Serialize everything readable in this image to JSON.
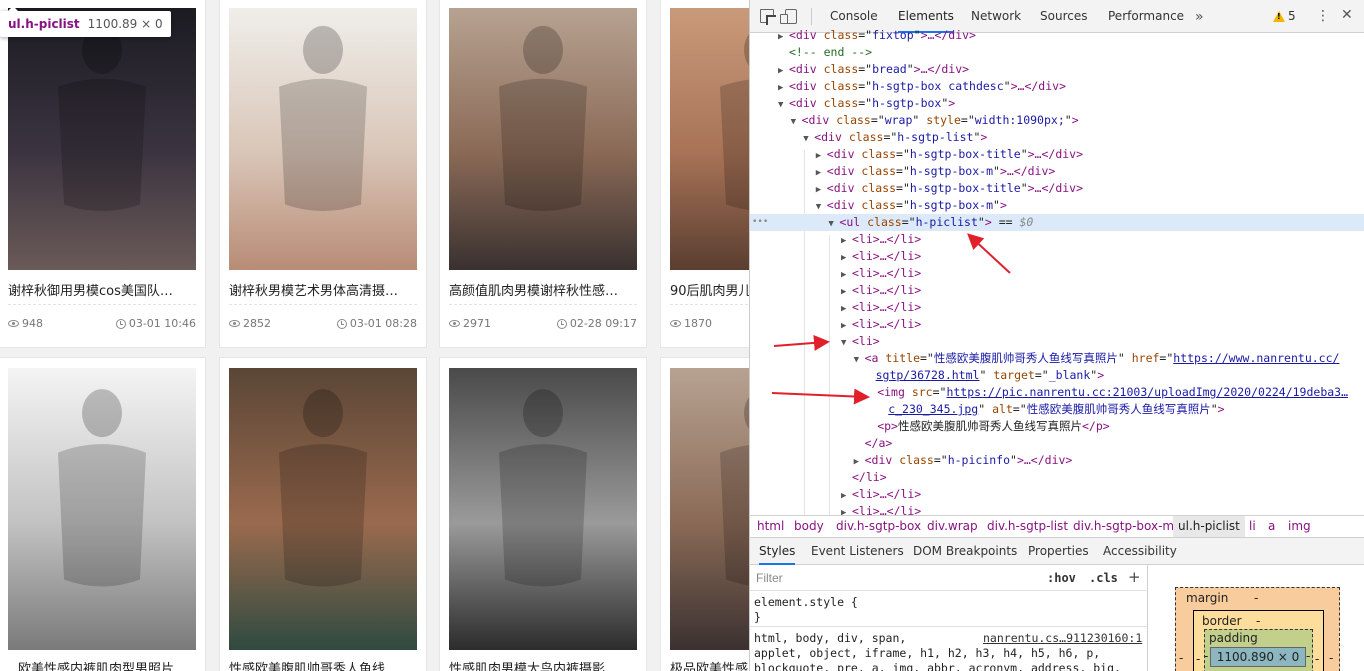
{
  "webpage": {
    "tooltip": {
      "selector": "ul.h-piclist",
      "dimensions": "1100.89 × 0"
    },
    "cards": [
      {
        "title": "谢梓秋御用男模cos美国队…",
        "views": "948",
        "date": "03-01 10:46",
        "photo_tone": "dark"
      },
      {
        "title": "谢梓秋男模艺术男体高清摄…",
        "views": "2852",
        "date": "03-01 08:28",
        "photo_tone": "light"
      },
      {
        "title": "高颜值肌肉男模谢梓秋性感…",
        "views": "2971",
        "date": "02-28 09:17",
        "photo_tone": "warm"
      },
      {
        "title": "90后肌肉男儿",
        "views": "1870",
        "date": "",
        "photo_tone": "tan"
      },
      {
        "title": "欧美性感内裤肌肉型男照片",
        "views": "",
        "date": "",
        "photo_tone": "bw"
      },
      {
        "title": "性感欧美腹肌帅哥秀人鱼线…",
        "views": "",
        "date": "",
        "photo_tone": "tan-green"
      },
      {
        "title": "性感肌肉男模大鸟内裤摄影…",
        "views": "",
        "date": "",
        "photo_tone": "bw-dark"
      },
      {
        "title": "极品欧美性感",
        "views": "",
        "date": "",
        "photo_tone": "warm"
      }
    ]
  },
  "devtools": {
    "tabs": [
      "Console",
      "Elements",
      "Network",
      "Sources",
      "Performance"
    ],
    "active_tab": "Elements",
    "more_tabs_icon": "»",
    "warning_count": "5",
    "dom_lines": [
      {
        "indent": 0,
        "tri": "▶",
        "parts": [
          [
            "tag",
            "<div "
          ],
          [
            "attr",
            "class"
          ],
          [
            "eq",
            "=\""
          ],
          [
            "val",
            "fixtop"
          ],
          [
            "eq",
            "\""
          ],
          [
            "tag",
            ">…</div>"
          ]
        ]
      },
      {
        "indent": 0,
        "tri": "",
        "parts": [
          [
            "cmt",
            "<!-- end -->"
          ]
        ]
      },
      {
        "indent": 0,
        "tri": "▶",
        "parts": [
          [
            "tag",
            "<div "
          ],
          [
            "attr",
            "class"
          ],
          [
            "eq",
            "=\""
          ],
          [
            "val",
            "bread"
          ],
          [
            "eq",
            "\""
          ],
          [
            "tag",
            ">…</div>"
          ]
        ]
      },
      {
        "indent": 0,
        "tri": "▶",
        "parts": [
          [
            "tag",
            "<div "
          ],
          [
            "attr",
            "class"
          ],
          [
            "eq",
            "=\""
          ],
          [
            "val",
            "h-sgtp-box cathdesc"
          ],
          [
            "eq",
            "\""
          ],
          [
            "tag",
            ">…</div>"
          ]
        ]
      },
      {
        "indent": 0,
        "tri": "▼",
        "parts": [
          [
            "tag",
            "<div "
          ],
          [
            "attr",
            "class"
          ],
          [
            "eq",
            "=\""
          ],
          [
            "val",
            "h-sgtp-box"
          ],
          [
            "eq",
            "\""
          ],
          [
            "tag",
            ">"
          ]
        ]
      },
      {
        "indent": 1,
        "tri": "▼",
        "parts": [
          [
            "tag",
            "<div "
          ],
          [
            "attr",
            "class"
          ],
          [
            "eq",
            "=\""
          ],
          [
            "val",
            "wrap"
          ],
          [
            "eq",
            "\" "
          ],
          [
            "attr",
            "style"
          ],
          [
            "eq",
            "=\""
          ],
          [
            "val",
            "width:1090px;"
          ],
          [
            "eq",
            "\""
          ],
          [
            "tag",
            ">"
          ]
        ]
      },
      {
        "indent": 2,
        "tri": "▼",
        "parts": [
          [
            "tag",
            "<div "
          ],
          [
            "attr",
            "class"
          ],
          [
            "eq",
            "=\""
          ],
          [
            "val",
            "h-sgtp-list"
          ],
          [
            "eq",
            "\""
          ],
          [
            "tag",
            ">"
          ]
        ]
      },
      {
        "indent": 3,
        "tri": "▶",
        "parts": [
          [
            "tag",
            "<div "
          ],
          [
            "attr",
            "class"
          ],
          [
            "eq",
            "=\""
          ],
          [
            "val",
            "h-sgtp-box-title"
          ],
          [
            "eq",
            "\""
          ],
          [
            "tag",
            ">…</div>"
          ]
        ]
      },
      {
        "indent": 3,
        "tri": "▶",
        "parts": [
          [
            "tag",
            "<div "
          ],
          [
            "attr",
            "class"
          ],
          [
            "eq",
            "=\""
          ],
          [
            "val",
            "h-sgtp-box-m"
          ],
          [
            "eq",
            "\""
          ],
          [
            "tag",
            ">…</div>"
          ]
        ]
      },
      {
        "indent": 3,
        "tri": "▶",
        "parts": [
          [
            "tag",
            "<div "
          ],
          [
            "attr",
            "class"
          ],
          [
            "eq",
            "=\""
          ],
          [
            "val",
            "h-sgtp-box-title"
          ],
          [
            "eq",
            "\""
          ],
          [
            "tag",
            ">…</div>"
          ]
        ]
      },
      {
        "indent": 3,
        "tri": "▼",
        "parts": [
          [
            "tag",
            "<div "
          ],
          [
            "attr",
            "class"
          ],
          [
            "eq",
            "=\""
          ],
          [
            "val",
            "h-sgtp-box-m"
          ],
          [
            "eq",
            "\""
          ],
          [
            "tag",
            ">"
          ]
        ]
      },
      {
        "indent": 4,
        "tri": "▼",
        "selected": true,
        "parts": [
          [
            "tag",
            "<ul "
          ],
          [
            "attr",
            "class"
          ],
          [
            "eq",
            "=\""
          ],
          [
            "val",
            "h-piclist"
          ],
          [
            "eq",
            "\""
          ],
          [
            "tag",
            ">"
          ],
          [
            "eq",
            " == "
          ],
          [
            "sel",
            "$0"
          ]
        ]
      },
      {
        "indent": 5,
        "tri": "▶",
        "parts": [
          [
            "tag",
            "<li>…</li>"
          ]
        ]
      },
      {
        "indent": 5,
        "tri": "▶",
        "parts": [
          [
            "tag",
            "<li>…</li>"
          ]
        ]
      },
      {
        "indent": 5,
        "tri": "▶",
        "parts": [
          [
            "tag",
            "<li>…</li>"
          ]
        ]
      },
      {
        "indent": 5,
        "tri": "▶",
        "parts": [
          [
            "tag",
            "<li>…</li>"
          ]
        ]
      },
      {
        "indent": 5,
        "tri": "▶",
        "parts": [
          [
            "tag",
            "<li>…</li>"
          ]
        ]
      },
      {
        "indent": 5,
        "tri": "▶",
        "parts": [
          [
            "tag",
            "<li>…</li>"
          ]
        ]
      },
      {
        "indent": 5,
        "tri": "▼",
        "parts": [
          [
            "tag",
            "<li>"
          ]
        ]
      },
      {
        "indent": 6,
        "tri": "▼",
        "parts": [
          [
            "tag",
            "<a "
          ],
          [
            "attr",
            "title"
          ],
          [
            "eq",
            "=\""
          ],
          [
            "val",
            "性感欧美腹肌帅哥秀人鱼线写真照片"
          ],
          [
            "eq",
            "\" "
          ],
          [
            "attr",
            "href"
          ],
          [
            "eq",
            "=\""
          ],
          [
            "lnk",
            "https://www.nanrentu.cc/"
          ]
        ]
      },
      {
        "indent": 6,
        "tri": "",
        "parts": [
          [
            "lnk",
            "sgtp/36728.html"
          ],
          [
            "eq",
            "\" "
          ],
          [
            "attr",
            "target"
          ],
          [
            "eq",
            "=\""
          ],
          [
            "val",
            "_blank"
          ],
          [
            "eq",
            "\""
          ],
          [
            "tag",
            ">"
          ]
        ]
      },
      {
        "indent": 7,
        "tri": "",
        "parts": [
          [
            "tag",
            "<img "
          ],
          [
            "attr",
            "src"
          ],
          [
            "eq",
            "=\""
          ],
          [
            "lnk",
            "https://pic.nanrentu.cc:21003/uploadImg/2020/0224/19deba3…"
          ]
        ]
      },
      {
        "indent": 7,
        "tri": "",
        "parts": [
          [
            "lnk",
            "c_230_345.jpg"
          ],
          [
            "eq",
            "\" "
          ],
          [
            "attr",
            "alt"
          ],
          [
            "eq",
            "=\""
          ],
          [
            "val",
            "性感欧美腹肌帅哥秀人鱼线写真照片"
          ],
          [
            "eq",
            "\""
          ],
          [
            "tag",
            ">"
          ]
        ]
      },
      {
        "indent": 7,
        "tri": "",
        "parts": [
          [
            "tag",
            "<p>"
          ],
          [
            "txt",
            "性感欧美腹肌帅哥秀人鱼线写真照片"
          ],
          [
            "tag",
            "</p>"
          ]
        ]
      },
      {
        "indent": 6,
        "tri": "",
        "parts": [
          [
            "tag",
            "</a>"
          ]
        ]
      },
      {
        "indent": 6,
        "tri": "▶",
        "parts": [
          [
            "tag",
            "<div "
          ],
          [
            "attr",
            "class"
          ],
          [
            "eq",
            "=\""
          ],
          [
            "val",
            "h-picinfo"
          ],
          [
            "eq",
            "\""
          ],
          [
            "tag",
            ">…</div>"
          ]
        ]
      },
      {
        "indent": 5,
        "tri": "",
        "parts": [
          [
            "tag",
            "</li>"
          ]
        ]
      },
      {
        "indent": 5,
        "tri": "▶",
        "parts": [
          [
            "tag",
            "<li>…</li>"
          ]
        ]
      },
      {
        "indent": 5,
        "tri": "▶",
        "parts": [
          [
            "tag",
            "<li>…</li>"
          ]
        ]
      }
    ],
    "breadcrumbs": [
      "html",
      "body",
      "div.h-sgtp-box",
      "div.wrap",
      "div.h-sgtp-list",
      "div.h-sgtp-box-m",
      "ul.h-piclist",
      "li",
      "a",
      "img"
    ],
    "active_crumb": "ul.h-piclist",
    "sub_tabs": [
      "Styles",
      "Event Listeners",
      "DOM Breakpoints",
      "Properties",
      "Accessibility"
    ],
    "active_sub_tab": "Styles",
    "filter_placeholder": "Filter",
    "hov_label": ":hov",
    "cls_label": ".cls",
    "add_rule_icon": "+",
    "rules": {
      "element_style_open": "element.style {",
      "element_style_close": "}",
      "rule2_line1": "html, body, div, span,",
      "rule2_line2": "applet, object, iframe, h1, h2, h3, h4, h5, h6, p,",
      "rule2_line3": "blockquote, pre, a, img, abbr, acronym, address, big,",
      "rule2_source": "nanrentu.cs…911230160:1"
    },
    "box_model": {
      "margin_label": "margin",
      "border_label": "border",
      "padding_label": "padding",
      "content": "1100.890 × 0",
      "dash": "-"
    },
    "colors": {
      "annotation_arrow": "#e0202a",
      "selection": "#dbe9f8",
      "tab_accent": "#1a73e8"
    }
  }
}
